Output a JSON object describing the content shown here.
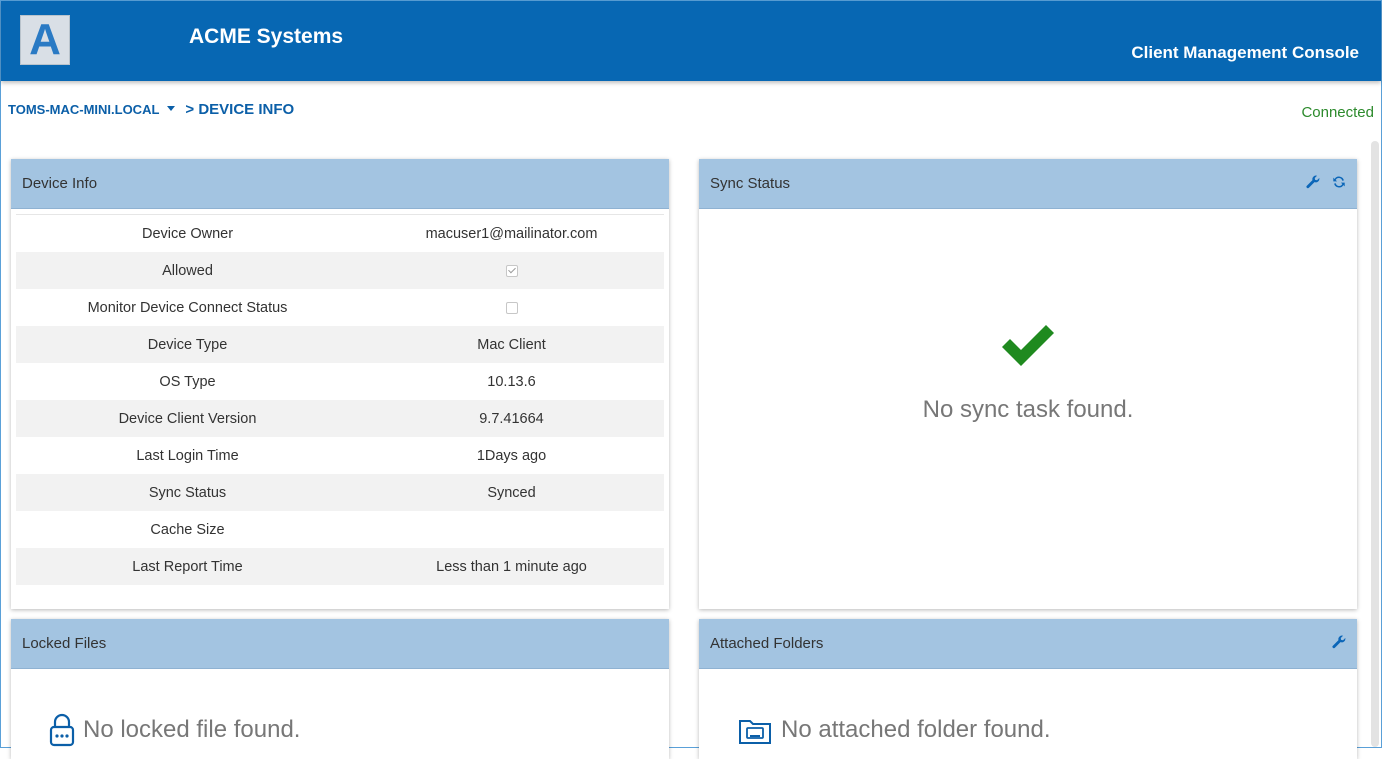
{
  "header": {
    "logo_letter": "A",
    "company": "ACME Systems",
    "console_title": "Client Management Console"
  },
  "breadcrumb": {
    "device": "TOMS-MAC-MINI.LOCAL",
    "page": "> DEVICE INFO"
  },
  "connection_status": "Connected",
  "device_info": {
    "title": "Device Info",
    "rows": [
      {
        "label": "Device Owner",
        "value": "macuser1@mailinator.com"
      },
      {
        "label": "Allowed",
        "checkbox": true,
        "checked": true
      },
      {
        "label": "Monitor Device Connect Status",
        "checkbox": true,
        "checked": false
      },
      {
        "label": "Device Type",
        "value": "Mac Client"
      },
      {
        "label": "OS Type",
        "value": "10.13.6"
      },
      {
        "label": "Device Client Version",
        "value": "9.7.41664"
      },
      {
        "label": "Last Login Time",
        "value": "1Days ago"
      },
      {
        "label": "Sync Status",
        "value": "Synced"
      },
      {
        "label": "Cache Size",
        "value": ""
      },
      {
        "label": "Last Report Time",
        "value": "Less than 1 minute ago"
      }
    ]
  },
  "sync_status": {
    "title": "Sync Status",
    "empty_message": "No sync task found.",
    "tools": [
      "wrench-icon",
      "refresh-icon"
    ]
  },
  "locked_files": {
    "title": "Locked Files",
    "empty_message": "No locked file found.",
    "icon": "lock-icon"
  },
  "attached_folders": {
    "title": "Attached Folders",
    "empty_message": "No attached folder found.",
    "icon": "folder-icon",
    "tools": [
      "wrench-icon"
    ]
  },
  "colors": {
    "header_bg": "#0767b3",
    "panel_header_bg": "#a3c4e1",
    "accent_blue": "#0b5fa8",
    "connected_green": "#2c8a2c",
    "check_green": "#1f8a1f"
  }
}
